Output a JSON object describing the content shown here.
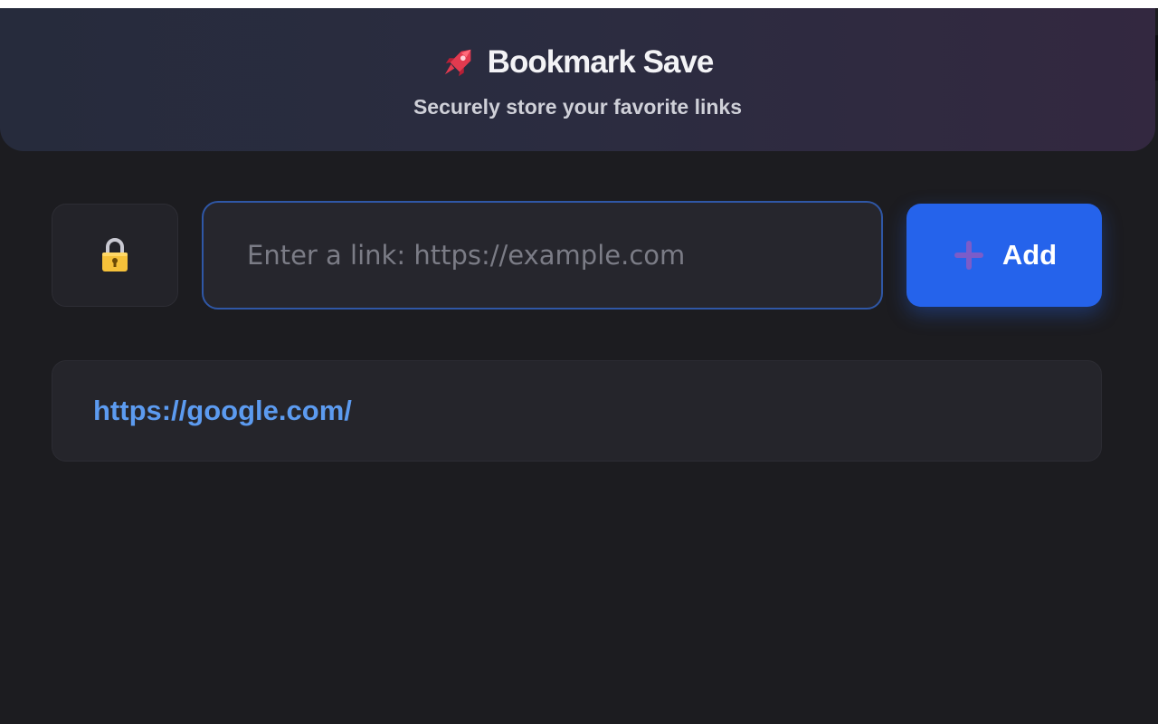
{
  "app": {
    "title": "Bookmark Save",
    "subtitle": "Securely store your favorite links"
  },
  "icons": {
    "logo": "rocket-icon",
    "lock": "lock-icon",
    "add": "plus-icon"
  },
  "input": {
    "value": "",
    "placeholder": "Enter a link: https://example.com"
  },
  "add_button": {
    "label": "Add"
  },
  "bookmarks": [
    {
      "url": "https://google.com/"
    }
  ],
  "colors": {
    "accent": "#2563eb",
    "link": "#5c9bf0",
    "plus": "#7b5cc9",
    "lock": "#f5c13a",
    "rocket": "#e23a4f"
  }
}
